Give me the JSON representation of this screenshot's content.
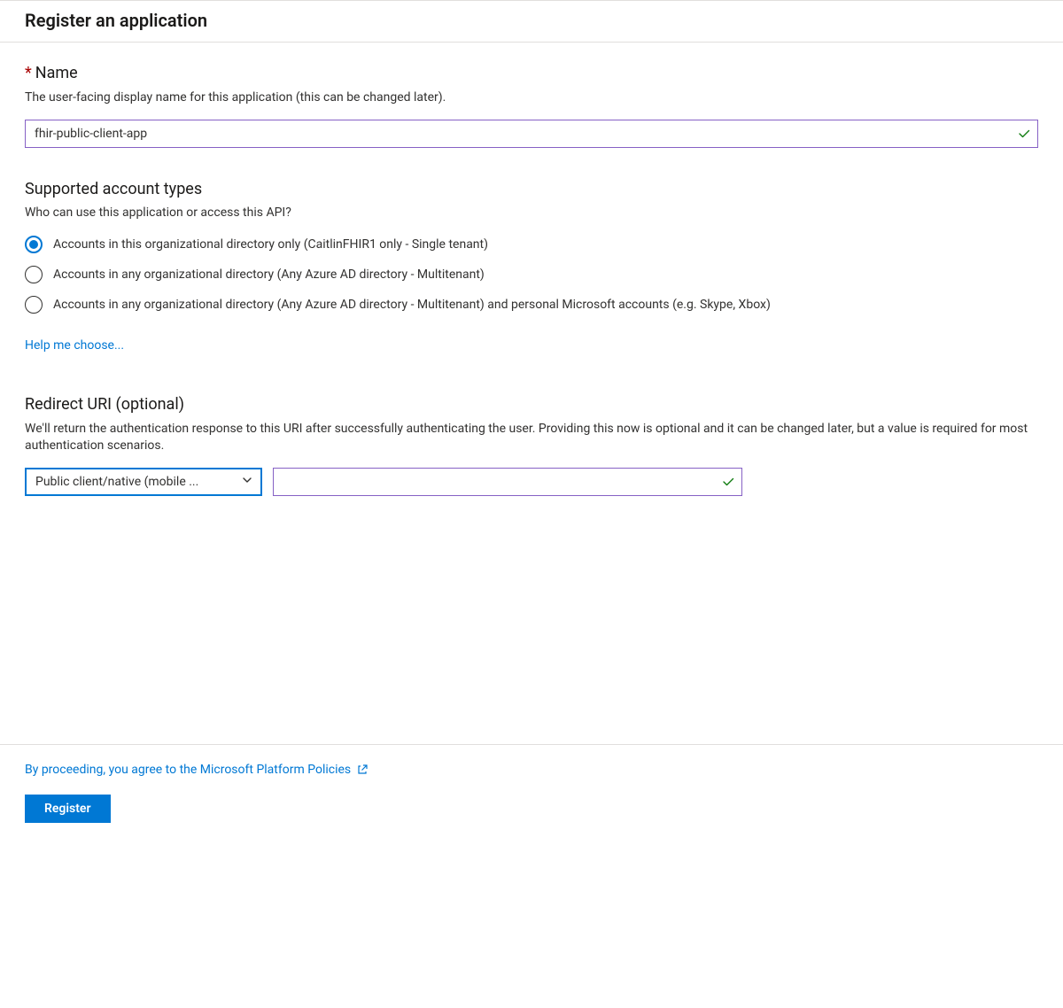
{
  "header": {
    "title": "Register an application"
  },
  "name_section": {
    "title": "Name",
    "desc": "The user-facing display name for this application (this can be changed later).",
    "value": "fhir-public-client-app"
  },
  "account_types": {
    "title": "Supported account types",
    "desc": "Who can use this application or access this API?",
    "options": [
      {
        "label": "Accounts in this organizational directory only (CaitlinFHIR1 only - Single tenant)",
        "selected": true
      },
      {
        "label": "Accounts in any organizational directory (Any Azure AD directory - Multitenant)",
        "selected": false
      },
      {
        "label": "Accounts in any organizational directory (Any Azure AD directory - Multitenant) and personal Microsoft accounts (e.g. Skype, Xbox)",
        "selected": false
      }
    ],
    "help_link": "Help me choose..."
  },
  "redirect": {
    "title": "Redirect URI (optional)",
    "desc": "We'll return the authentication response to this URI after successfully authenticating the user. Providing this now is optional and it can be changed later, but a value is required for most authentication scenarios.",
    "platform_selected": "Public client/native (mobile ...",
    "uri_value": ""
  },
  "footer": {
    "policy_text": "By proceeding, you agree to the Microsoft Platform Policies",
    "register_label": "Register"
  }
}
